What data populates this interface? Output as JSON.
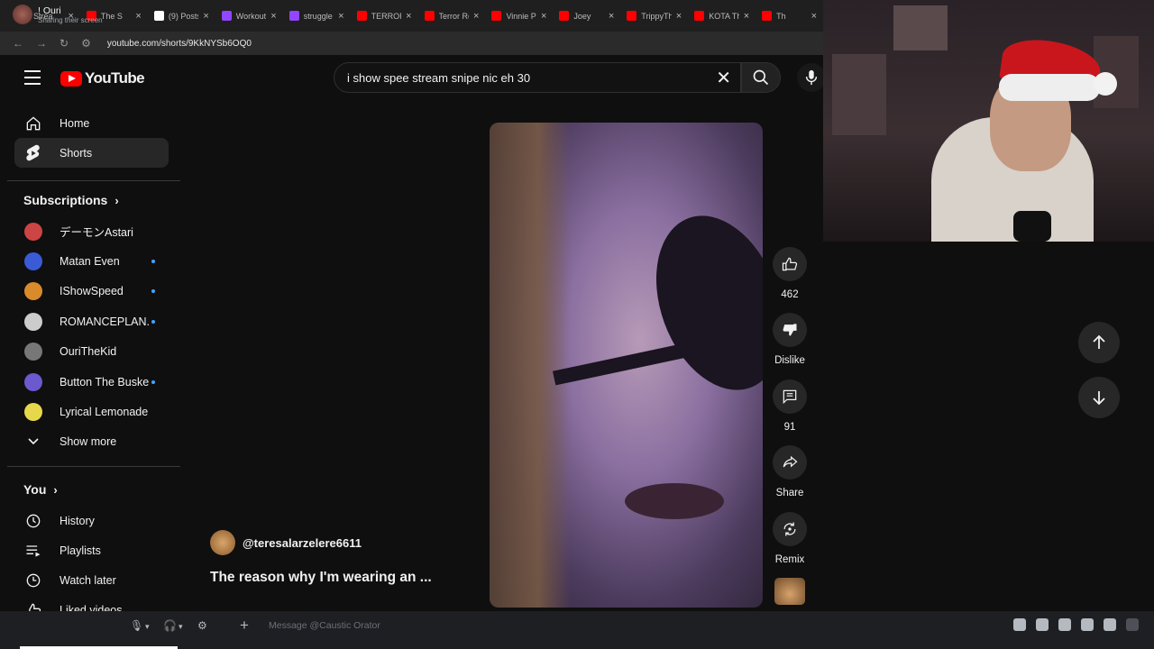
{
  "browser": {
    "tabs": [
      {
        "title": "Strea",
        "color": "#53fc18"
      },
      {
        "title": "The S",
        "color": "#ff0000"
      },
      {
        "title": "(9) Posts",
        "color": "#ffffff"
      },
      {
        "title": "Workout",
        "color": "#9146ff"
      },
      {
        "title": "struggle",
        "color": "#9146ff"
      },
      {
        "title": "TERROR",
        "color": "#ff0000"
      },
      {
        "title": "Terror Re",
        "color": "#ff0000"
      },
      {
        "title": "Vinnie Pa",
        "color": "#ff0000"
      },
      {
        "title": "Joey",
        "color": "#ff0000"
      },
      {
        "title": "TrippyTh",
        "color": "#ff0000"
      },
      {
        "title": "KOTA Th",
        "color": "#ff0000"
      },
      {
        "title": "Th",
        "color": "#ff0000"
      }
    ],
    "url": "youtube.com/shorts/9KkNYSb6OQ0"
  },
  "header": {
    "logo_text": "YouTube",
    "search_query": "i show spee stream snipe nic eh 30"
  },
  "sidebar": {
    "main_items": [
      {
        "label": "Home",
        "icon": "home-icon"
      },
      {
        "label": "Shorts",
        "icon": "shorts-icon"
      }
    ],
    "subscriptions_title": "Subscriptions",
    "subscriptions": [
      {
        "label": "デーモンAstari",
        "dot": false,
        "color": "#c44"
      },
      {
        "label": "Matan Even",
        "dot": true,
        "color": "#3b5bd6"
      },
      {
        "label": "IShowSpeed",
        "dot": true,
        "color": "#d98b2b"
      },
      {
        "label": "ROMANCEPLAN...",
        "dot": true,
        "color": "#cccccc"
      },
      {
        "label": "OuriTheKid",
        "dot": false,
        "color": "#777777"
      },
      {
        "label": "Button The Busker",
        "dot": true,
        "color": "#6a5acd"
      },
      {
        "label": "Lyrical Lemonade",
        "dot": false,
        "color": "#e6d84a"
      }
    ],
    "show_more": "Show more",
    "you_title": "You",
    "you_items": [
      {
        "label": "History",
        "icon": "history-icon"
      },
      {
        "label": "Playlists",
        "icon": "playlists-icon"
      },
      {
        "label": "Watch later",
        "icon": "watch-later-icon"
      },
      {
        "label": "Liked videos",
        "icon": "liked-videos-icon"
      }
    ]
  },
  "short": {
    "channel": "@teresalarzelere6611",
    "title": "The reason why I'm wearing an ...",
    "actions": {
      "likes": "462",
      "dislike": "Dislike",
      "comments": "91",
      "share": "Share",
      "remix": "Remix"
    }
  },
  "discord": {
    "username": "! Ouri",
    "status": "Sharing their screen",
    "message_placeholder": "Message @Caustic Orator"
  }
}
